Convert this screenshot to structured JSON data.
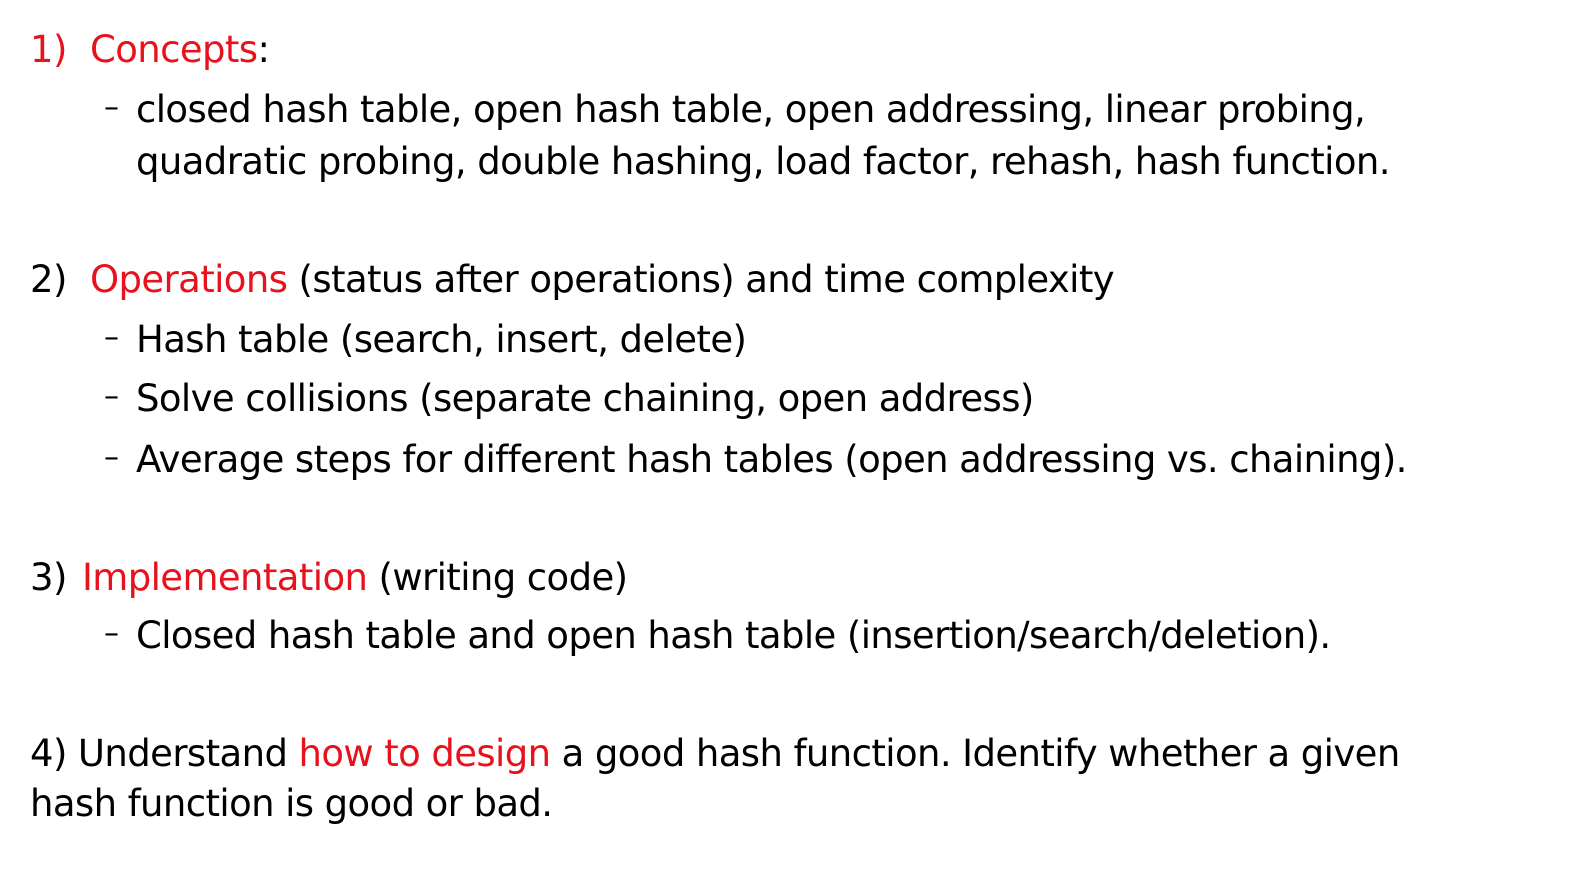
{
  "section1": {
    "number": "1)",
    "title": "Concepts",
    "after": ":",
    "bullet_line1": "closed hash table, open hash table, open addressing, linear probing,",
    "bullet_line2": "quadratic probing, double hashing, load factor, rehash, hash function."
  },
  "section2": {
    "number": "2)",
    "title": "Operations",
    "after": " (status after operations) and time complexity",
    "bullets": [
      "Hash table (search, insert, delete)",
      "Solve collisions (separate chaining, open address)",
      "Average steps for different hash tables (open addressing vs. chaining)."
    ]
  },
  "section3": {
    "number": "3)",
    "title": "Implementation",
    "after": " (writing code)",
    "bullets": [
      "Closed hash table and open hash table (insertion/search/deletion)."
    ]
  },
  "section4": {
    "before": "4) Understand ",
    "highlight": "how to design",
    "after": " a good hash function. Identify whether a given",
    "line2": "hash function is good or bad."
  },
  "bullet_marker": "–",
  "colors": {
    "accent": "#e8111c",
    "text": "#000000",
    "background": "#ffffff"
  }
}
